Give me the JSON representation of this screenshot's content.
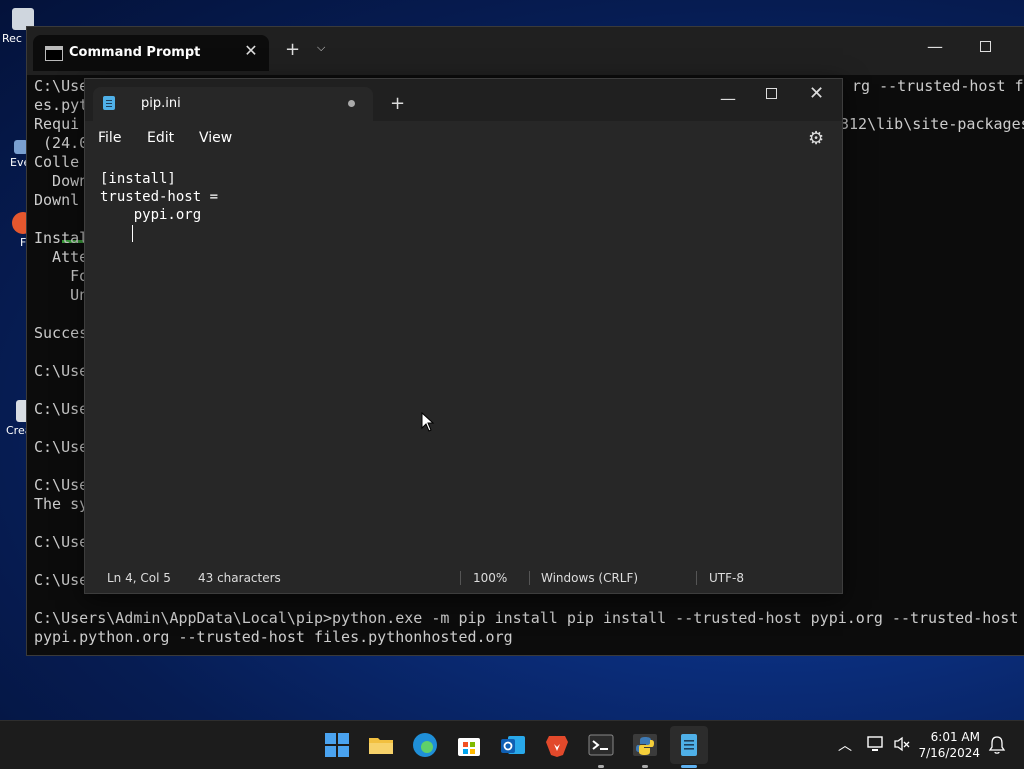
{
  "desktop": {
    "icons": [
      {
        "label": "Rec"
      },
      {
        "label": "Eve"
      },
      {
        "label": "F"
      },
      {
        "label": "Crea"
      }
    ]
  },
  "cmd": {
    "title": "Command Prompt",
    "lines": [
      "C:\\Use",
      "es.pyt",
      "Requi",
      " (24.0",
      "Colle",
      "  Down",
      "Downl",
      "",
      "Instal",
      "  Atte",
      "    Fo",
      "    Un",
      "",
      "Succes",
      "",
      "C:\\Use",
      "",
      "C:\\Use",
      "",
      "C:\\Use",
      "",
      "C:\\Use",
      "The sy",
      "",
      "C:\\Use",
      "",
      "C:\\Use",
      "",
      "C:\\Users\\Admin\\AppData\\Local\\pip>python.exe -m pip install pip install --trusted-host pypi.org --trusted-host",
      "pypi.python.org --trusted-host files.pythonhosted.org"
    ],
    "right_text_line1": "rg --trusted-host fil",
    "right_text_line3": "312\\lib\\site-packages"
  },
  "notepad": {
    "tab_title": "pip.ini",
    "menu": [
      "File",
      "Edit",
      "View"
    ],
    "content": "[install]\ntrusted-host =\n    pypi.org\n",
    "status": {
      "position": "Ln 4, Col 5",
      "chars": "43 characters",
      "zoom": "100%",
      "line_ending": "Windows (CRLF)",
      "encoding": "UTF-8"
    }
  },
  "taskbar": {
    "apps": [
      {
        "name": "start",
        "color": "#4aa3f0"
      },
      {
        "name": "file-explorer",
        "color": "#f2c040"
      },
      {
        "name": "edge",
        "color": "#2fa7d8"
      },
      {
        "name": "microsoft-store",
        "color": "#ffffff"
      },
      {
        "name": "outlook",
        "color": "#1f6fc9"
      },
      {
        "name": "brave",
        "color": "#e2492b"
      },
      {
        "name": "terminal",
        "color": "#3a3a3a"
      },
      {
        "name": "python",
        "color": "#3e7ab5"
      },
      {
        "name": "notepad",
        "color": "#4fb0e8"
      }
    ],
    "time": "6:01 AM",
    "date": "7/16/2024"
  }
}
